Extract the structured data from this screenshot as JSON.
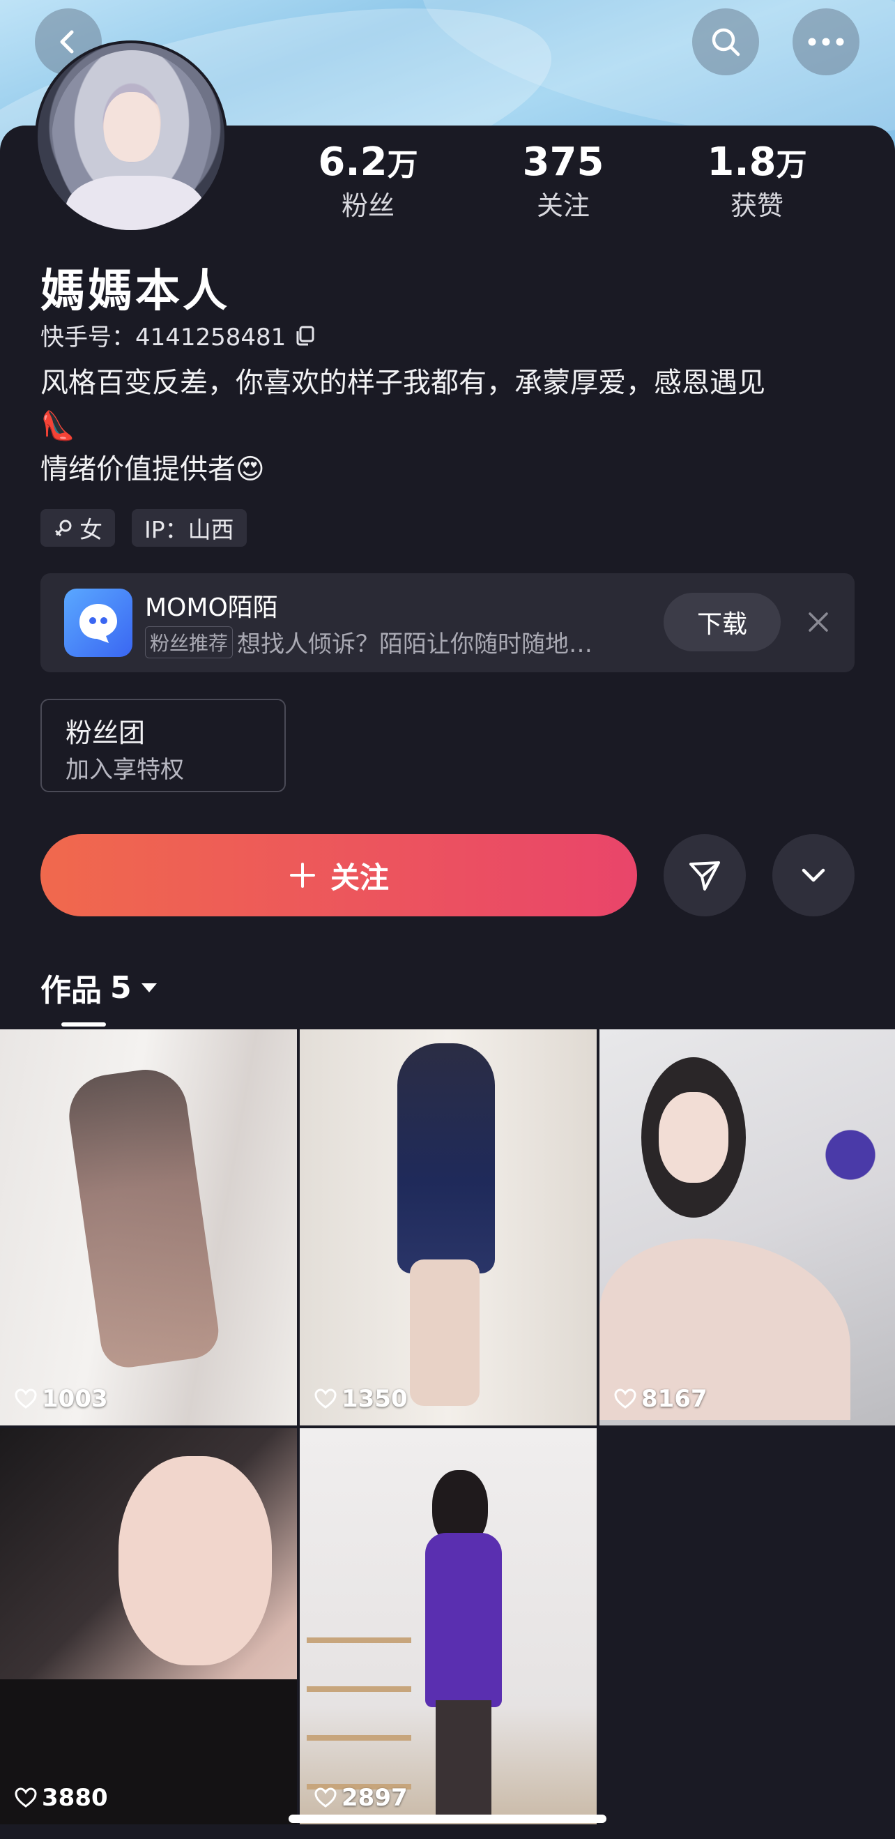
{
  "header": {
    "back_icon": "chevron-left-icon",
    "search_icon": "search-icon",
    "more_icon": "more-horizontal-icon"
  },
  "profile": {
    "name": "媽媽本人",
    "id_label": "快手号：4141258481",
    "bio_line1": "风格百变反差，你喜欢的样子我都有，承蒙厚爱，感恩遇见",
    "bio_emoji1": "👠",
    "bio_line2": "情绪价值提供者",
    "bio_emoji2": "😍",
    "tags": {
      "gender": "女",
      "gender_icon": "female-icon",
      "ip": "IP：山西"
    }
  },
  "stats": {
    "fans": {
      "num": "6.2",
      "unit": "万",
      "label": "粉丝"
    },
    "following": {
      "num": "375",
      "unit": "",
      "label": "关注"
    },
    "likes": {
      "num": "1.8",
      "unit": "万",
      "label": "获赞"
    }
  },
  "ad": {
    "title": "MOMO陌陌",
    "badge": "粉丝推荐",
    "text": "想找人倾诉？陌陌让你随时随地…",
    "download": "下载"
  },
  "fan_club": {
    "title": "粉丝团",
    "subtitle": "加入享特权"
  },
  "actions": {
    "follow": "关注"
  },
  "works": {
    "label": "作品",
    "count": "5",
    "items": [
      {
        "likes": "1003"
      },
      {
        "likes": "1350"
      },
      {
        "likes": "8167"
      },
      {
        "likes": "3880"
      },
      {
        "likes": "2897"
      }
    ]
  },
  "colors": {
    "background": "#1a1a24",
    "follow_start": "#f0694d",
    "follow_end": "#e9456a"
  }
}
